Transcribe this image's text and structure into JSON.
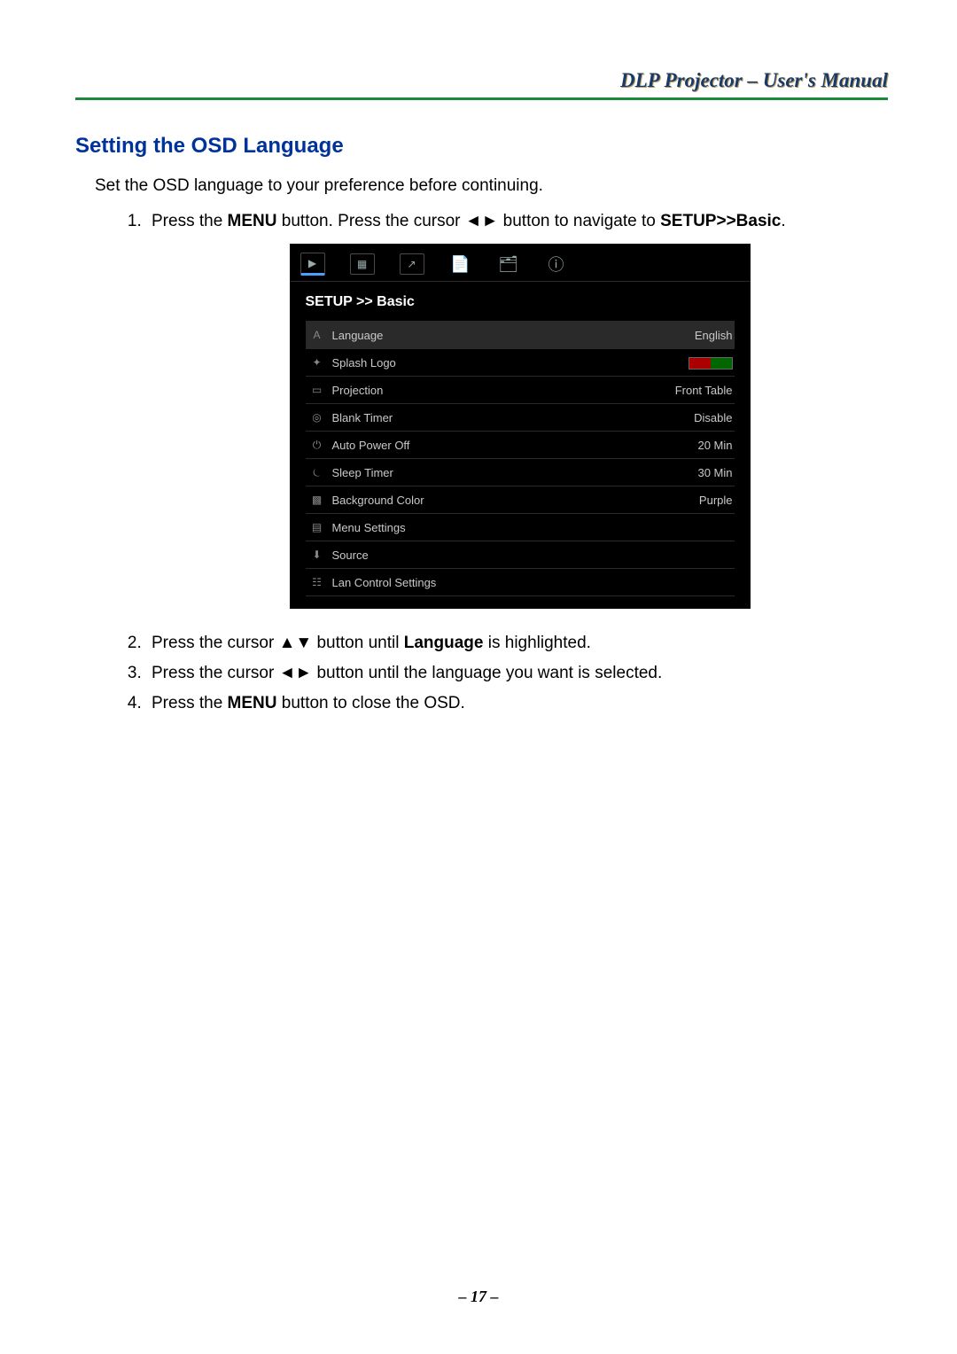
{
  "header": {
    "title": "DLP Projector – User's Manual"
  },
  "section_title": "Setting the OSD Language",
  "intro": "Set the OSD language to your preference before continuing.",
  "steps": {
    "s1": {
      "pre": "Press the ",
      "b1": "MENU",
      "mid": " button. Press the cursor ◄► button to navigate to ",
      "b2": "SETUP>>Basic",
      "post": "."
    },
    "s2": {
      "pre": "Press the cursor ▲▼ button until ",
      "b1": "Language",
      "post": " is highlighted."
    },
    "s3": {
      "text": "Press the cursor ◄► button until the language you want is selected."
    },
    "s4": {
      "pre": "Press the ",
      "b1": "MENU",
      "post": " button to close the OSD."
    }
  },
  "osd": {
    "title": "SETUP >> Basic",
    "tabs": {
      "t0": "▶",
      "t1": "▦",
      "t2": "↗",
      "t3": "📄",
      "t4": "🗂",
      "t5": "ⓘ"
    },
    "rows": {
      "language": {
        "icon": "A",
        "label": "Language",
        "value": "English"
      },
      "splash": {
        "icon": "✦",
        "label": "Splash Logo",
        "value_is_swatch": true
      },
      "projection": {
        "icon": "▭",
        "label": "Projection",
        "value": "Front Table"
      },
      "blank": {
        "icon": "◎",
        "label": "Blank Timer",
        "value": "Disable"
      },
      "autopower": {
        "icon": "⏻",
        "label": "Auto Power Off",
        "value": "20 Min"
      },
      "sleep": {
        "icon": "⏾",
        "label": "Sleep Timer",
        "value": "30 Min"
      },
      "bgcolor": {
        "icon": "▩",
        "label": "Background Color",
        "value": "Purple"
      },
      "menuset": {
        "icon": "▤",
        "label": "Menu Settings",
        "value": ""
      },
      "source": {
        "icon": "⬇",
        "label": "Source",
        "value": ""
      },
      "lan": {
        "icon": "☷",
        "label": "Lan Control Settings",
        "value": ""
      }
    }
  },
  "page_number": "– 17 –"
}
